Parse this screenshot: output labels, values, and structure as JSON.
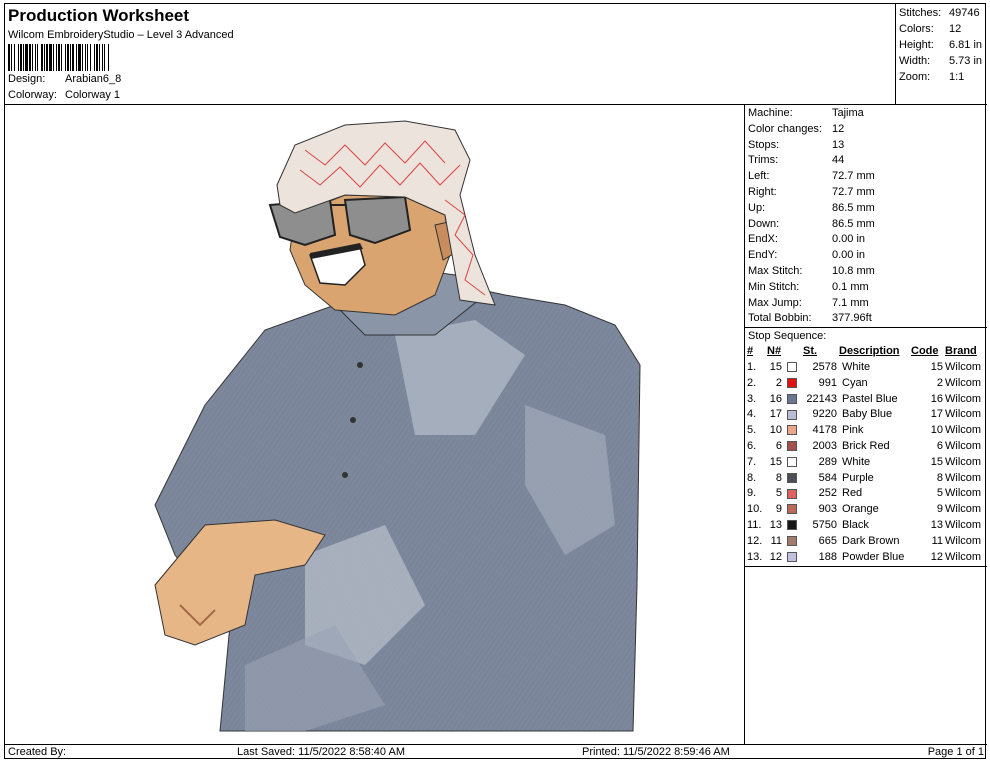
{
  "header": {
    "title": "Production Worksheet",
    "subtitle": "Wilcom EmbroideryStudio – Level 3 Advanced",
    "design_label": "Design:",
    "design_value": "Arabian6_8",
    "colorway_label": "Colorway:",
    "colorway_value": "Colorway 1"
  },
  "stats": [
    {
      "label": "Stitches:",
      "value": "49746"
    },
    {
      "label": "Colors:",
      "value": "12"
    },
    {
      "label": "Height:",
      "value": "6.81 in"
    },
    {
      "label": "Width:",
      "value": "5.73 in"
    },
    {
      "label": "Zoom:",
      "value": "1:1"
    }
  ],
  "machine_info": [
    {
      "label": "Machine:",
      "value": "Tajima"
    },
    {
      "label": "Color changes:",
      "value": "12"
    },
    {
      "label": "Stops:",
      "value": "13"
    },
    {
      "label": "Trims:",
      "value": "44"
    },
    {
      "label": "Left:",
      "value": "72.7 mm"
    },
    {
      "label": "Right:",
      "value": "72.7 mm"
    },
    {
      "label": "Up:",
      "value": "86.5 mm"
    },
    {
      "label": "Down:",
      "value": "86.5 mm"
    },
    {
      "label": "EndX:",
      "value": "0.00 in"
    },
    {
      "label": "EndY:",
      "value": "0.00 in"
    },
    {
      "label": "Max Stitch:",
      "value": "10.8 mm"
    },
    {
      "label": "Min Stitch:",
      "value": "0.1 mm"
    },
    {
      "label": "Max Jump:",
      "value": "7.1 mm"
    },
    {
      "label": "Total Bobbin:",
      "value": "377.96ft"
    }
  ],
  "stop_sequence": {
    "title": "Stop Sequence:",
    "headers": {
      "index": "#",
      "n": "N#",
      "st": "St.",
      "description": "Description",
      "code": "Code",
      "brand": "Brand"
    },
    "rows": [
      {
        "index": "1.",
        "n": "15",
        "color": "#ffffff",
        "st": "2578",
        "description": "White",
        "code": "15",
        "brand": "Wilcom"
      },
      {
        "index": "2.",
        "n": "2",
        "color": "#e0130f",
        "st": "991",
        "description": "Cyan",
        "code": "2",
        "brand": "Wilcom"
      },
      {
        "index": "3.",
        "n": "16",
        "color": "#6a7690",
        "st": "22143",
        "description": "Pastel Blue",
        "code": "16",
        "brand": "Wilcom"
      },
      {
        "index": "4.",
        "n": "17",
        "color": "#b9bcd6",
        "st": "9220",
        "description": "Baby Blue",
        "code": "17",
        "brand": "Wilcom"
      },
      {
        "index": "5.",
        "n": "10",
        "color": "#eaa68a",
        "st": "4178",
        "description": "Pink",
        "code": "10",
        "brand": "Wilcom"
      },
      {
        "index": "6.",
        "n": "6",
        "color": "#a54f4f",
        "st": "2003",
        "description": "Brick Red",
        "code": "6",
        "brand": "Wilcom"
      },
      {
        "index": "7.",
        "n": "15",
        "color": "#ffffff",
        "st": "289",
        "description": "White",
        "code": "15",
        "brand": "Wilcom"
      },
      {
        "index": "8.",
        "n": "8",
        "color": "#4d4d55",
        "st": "584",
        "description": "Purple",
        "code": "8",
        "brand": "Wilcom"
      },
      {
        "index": "9.",
        "n": "5",
        "color": "#e06060",
        "st": "252",
        "description": "Red",
        "code": "5",
        "brand": "Wilcom"
      },
      {
        "index": "10.",
        "n": "9",
        "color": "#b96a5a",
        "st": "903",
        "description": "Orange",
        "code": "9",
        "brand": "Wilcom"
      },
      {
        "index": "11.",
        "n": "13",
        "color": "#151515",
        "st": "5750",
        "description": "Black",
        "code": "13",
        "brand": "Wilcom"
      },
      {
        "index": "12.",
        "n": "11",
        "color": "#a27b6f",
        "st": "665",
        "description": "Dark Brown",
        "code": "11",
        "brand": "Wilcom"
      },
      {
        "index": "13.",
        "n": "12",
        "color": "#c2c0e0",
        "st": "188",
        "description": "Powder Blue",
        "code": "12",
        "brand": "Wilcom"
      }
    ]
  },
  "footer": {
    "created_by": "Created By:",
    "last_saved": "Last Saved: 11/5/2022 8:58:40 AM",
    "printed": "Printed: 11/5/2022 8:59:46 AM",
    "page": "Page 1 of 1"
  }
}
